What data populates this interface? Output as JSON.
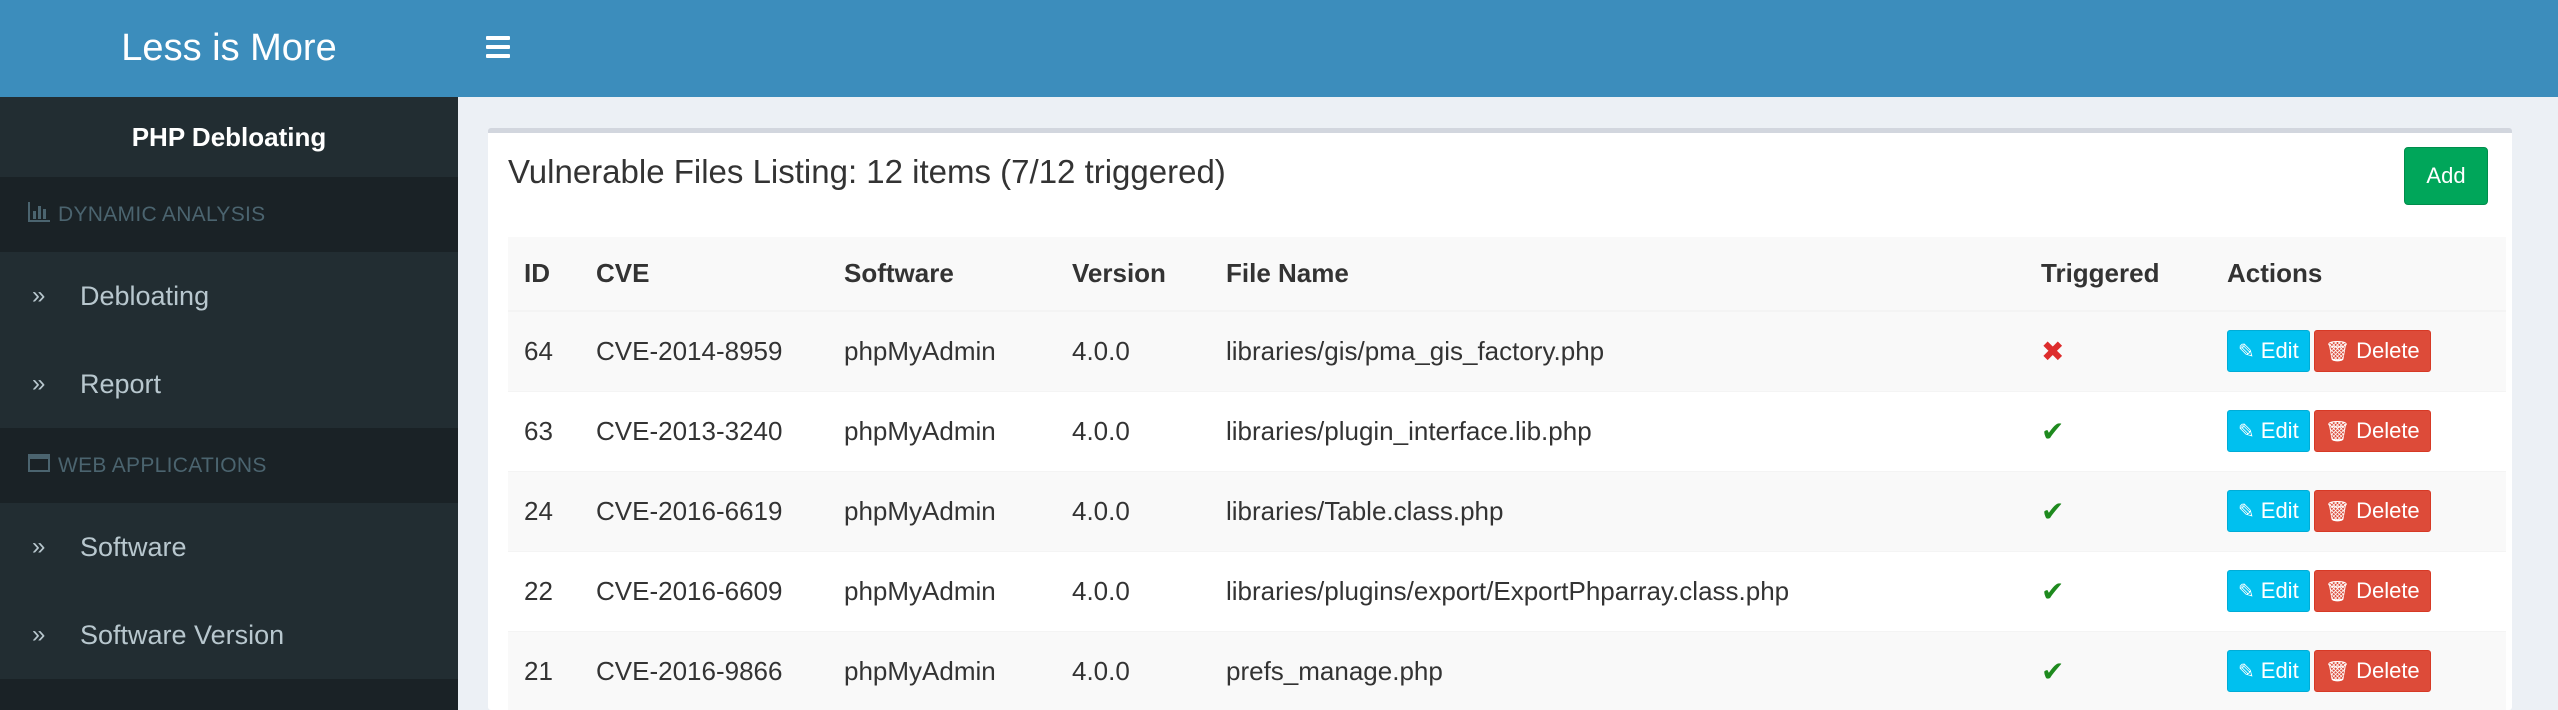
{
  "app": {
    "logo": "Less is More",
    "menu_icon": "hamburger-icon"
  },
  "sidebar": {
    "brand": "PHP Debloating",
    "sections": [
      {
        "title": "DYNAMIC ANALYSIS",
        "icon": "bar-chart-icon",
        "items": [
          {
            "label": "Debloating",
            "icon": "double-chevron-right-icon"
          },
          {
            "label": "Report",
            "icon": "double-chevron-right-icon"
          }
        ]
      },
      {
        "title": "WEB APPLICATIONS",
        "icon": "window-icon",
        "items": [
          {
            "label": "Software",
            "icon": "double-chevron-right-icon"
          },
          {
            "label": "Software Version",
            "icon": "double-chevron-right-icon"
          }
        ]
      }
    ]
  },
  "main": {
    "title": "Vulnerable Files Listing: 12 items (7/12 triggered)",
    "add_label": "Add",
    "columns": [
      "ID",
      "CVE",
      "Software",
      "Version",
      "File Name",
      "Triggered",
      "Actions"
    ],
    "edit_label": "Edit",
    "delete_label": "Delete",
    "rows": [
      {
        "id": "64",
        "cve": "CVE-2014-8959",
        "software": "phpMyAdmin",
        "version": "4.0.0",
        "file": "libraries/gis/pma_gis_factory.php",
        "triggered": "✖",
        "triggered_state": "no"
      },
      {
        "id": "63",
        "cve": "CVE-2013-3240",
        "software": "phpMyAdmin",
        "version": "4.0.0",
        "file": "libraries/plugin_interface.lib.php",
        "triggered": "✔",
        "triggered_state": "yes"
      },
      {
        "id": "24",
        "cve": "CVE-2016-6619",
        "software": "phpMyAdmin",
        "version": "4.0.0",
        "file": "libraries/Table.class.php",
        "triggered": "✔",
        "triggered_state": "yes"
      },
      {
        "id": "22",
        "cve": "CVE-2016-6609",
        "software": "phpMyAdmin",
        "version": "4.0.0",
        "file": "libraries/plugins/export/ExportPhparray.class.php",
        "triggered": "✔",
        "triggered_state": "yes"
      },
      {
        "id": "21",
        "cve": "CVE-2016-9866",
        "software": "phpMyAdmin",
        "version": "4.0.0",
        "file": "prefs_manage.php",
        "triggered": "✔",
        "triggered_state": "yes"
      }
    ]
  },
  "colors": {
    "header": "#3c8dbc",
    "sidebar": "#222d32",
    "add_button": "#00a65a",
    "edit_button": "#00c0ef",
    "delete_button": "#dd4b39",
    "triggered_yes": "#1e8a1e",
    "triggered_no": "#dd2c2c"
  }
}
